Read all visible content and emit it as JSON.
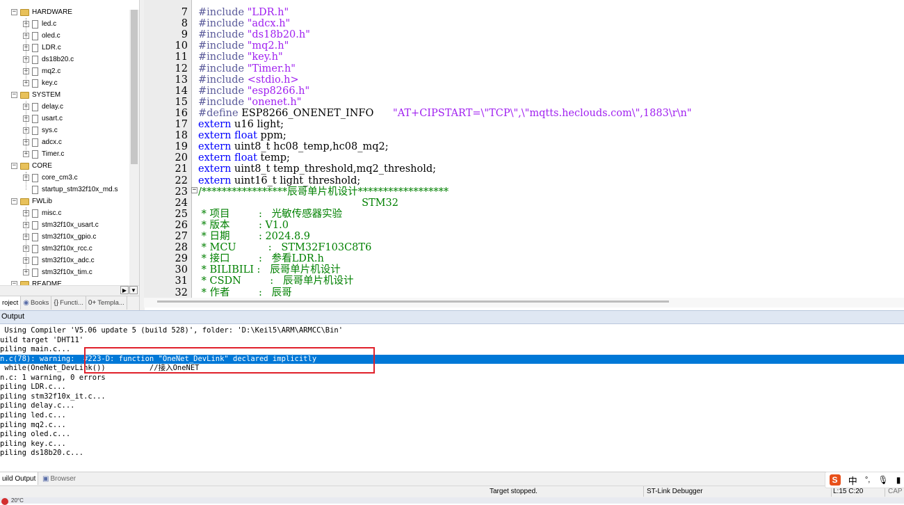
{
  "tree": {
    "groups": [
      {
        "name": "HARDWARE",
        "files": [
          "led.c",
          "oled.c",
          "LDR.c",
          "ds18b20.c",
          "mq2.c",
          "key.c"
        ]
      },
      {
        "name": "SYSTEM",
        "files": [
          "delay.c",
          "usart.c",
          "sys.c",
          "adcx.c",
          "Timer.c"
        ]
      },
      {
        "name": "CORE",
        "files": [
          "core_cm3.c",
          "startup_stm32f10x_md.s"
        ]
      },
      {
        "name": "FWLib",
        "files": [
          "misc.c",
          "stm32f10x_usart.c",
          "stm32f10x_gpio.c",
          "stm32f10x_rcc.c",
          "stm32f10x_adc.c",
          "stm32f10x_tim.c"
        ]
      },
      {
        "name": "README",
        "files": []
      }
    ]
  },
  "panel_tabs": [
    "roject",
    "Books",
    "Functi...",
    "Templa..."
  ],
  "editor": {
    "lines": [
      {
        "n": "7",
        "parts": [
          [
            "pp",
            "#include "
          ],
          [
            "st",
            "\"LDR.h\""
          ]
        ]
      },
      {
        "n": "8",
        "parts": [
          [
            "pp",
            "#include "
          ],
          [
            "st",
            "\"adcx.h\""
          ]
        ]
      },
      {
        "n": "9",
        "parts": [
          [
            "pp",
            "#include "
          ],
          [
            "st",
            "\"ds18b20.h\""
          ]
        ]
      },
      {
        "n": "10",
        "parts": [
          [
            "pp",
            "#include "
          ],
          [
            "st",
            "\"mq2.h\""
          ]
        ]
      },
      {
        "n": "11",
        "parts": [
          [
            "pp",
            "#include "
          ],
          [
            "st",
            "\"key.h\""
          ]
        ]
      },
      {
        "n": "12",
        "parts": [
          [
            "pp",
            "#include "
          ],
          [
            "st",
            "\"Timer.h\""
          ]
        ]
      },
      {
        "n": "13",
        "parts": [
          [
            "pp",
            "#include "
          ],
          [
            "st",
            "<stdio.h>"
          ]
        ]
      },
      {
        "n": "14",
        "parts": [
          [
            "pp",
            "#include "
          ],
          [
            "st",
            "\"esp8266.h\""
          ]
        ]
      },
      {
        "n": "15",
        "parts": [
          [
            "pp",
            "#include "
          ],
          [
            "st",
            "\"onenet.h\""
          ]
        ]
      },
      {
        "n": "16",
        "parts": [
          [
            "pp",
            "#define "
          ],
          [
            "tx",
            "ESP8266_ONENET_INFO      "
          ],
          [
            "st",
            "\"AT+CIPSTART=\\\"TCP\\\",\\\"mqtts.heclouds.com\\\",1883\\r\\n\""
          ]
        ]
      },
      {
        "n": "17",
        "parts": [
          [
            "kw",
            "extern "
          ],
          [
            "tx",
            "u16 light;"
          ]
        ]
      },
      {
        "n": "18",
        "parts": [
          [
            "kw",
            "extern float "
          ],
          [
            "tx",
            "ppm;"
          ]
        ]
      },
      {
        "n": "19",
        "parts": [
          [
            "kw",
            "extern "
          ],
          [
            "tx",
            "uint8_t hc08_temp,hc08_mq2;"
          ]
        ]
      },
      {
        "n": "20",
        "parts": [
          [
            "kw",
            "extern float "
          ],
          [
            "tx",
            "temp;"
          ]
        ]
      },
      {
        "n": "21",
        "parts": [
          [
            "kw",
            "extern "
          ],
          [
            "tx",
            "uint8_t temp_threshold,mq2_threshold;"
          ]
        ]
      },
      {
        "n": "22",
        "parts": [
          [
            "kw",
            "extern "
          ],
          [
            "tx",
            "uint16_t light_threshold;"
          ]
        ]
      },
      {
        "n": "23",
        "parts": [
          [
            "cm",
            "/*****************辰哥单片机设计******************"
          ]
        ]
      },
      {
        "n": "24",
        "parts": [
          [
            "cm",
            "                                                   STM32"
          ]
        ]
      },
      {
        "n": "25",
        "parts": [
          [
            "cm",
            " * 项目         :   光敏传感器实验"
          ]
        ]
      },
      {
        "n": "26",
        "parts": [
          [
            "cm",
            " * 版本         : V1.0"
          ]
        ]
      },
      {
        "n": "27",
        "parts": [
          [
            "cm",
            " * 日期         : 2024.8.9"
          ]
        ]
      },
      {
        "n": "28",
        "parts": [
          [
            "cm",
            " * MCU          :   STM32F103C8T6"
          ]
        ]
      },
      {
        "n": "29",
        "parts": [
          [
            "cm",
            " * 接口         :   参看LDR.h"
          ]
        ]
      },
      {
        "n": "30",
        "parts": [
          [
            "cm",
            " * BILIBILI :   辰哥单片机设计"
          ]
        ]
      },
      {
        "n": "31",
        "parts": [
          [
            "cm",
            " * CSDN         :   辰哥单片机设计"
          ]
        ]
      },
      {
        "n": "32",
        "parts": [
          [
            "cm",
            " * 作者         :   辰哥"
          ]
        ]
      }
    ]
  },
  "output": {
    "title": "Output",
    "lines": [
      " Using Compiler 'V5.06 update 5 (build 528)', folder: 'D:\\Keil5\\ARM\\ARMCC\\Bin'",
      "uild target 'DHT11'",
      "piling main.c...",
      "n.c(78): warning:  #223-D: function \"OneNet_DevLink\" declared implicitly",
      " while(OneNet_DevLink())          //接入OneNET",
      "n.c: 1 warning, 0 errors",
      "piling LDR.c...",
      "piling stm32f10x_it.c...",
      "piling delay.c...",
      "piling led.c...",
      "piling mq2.c...",
      "piling oled.c...",
      "piling key.c...",
      "piling ds18b20.c..."
    ],
    "selected_index": 3
  },
  "bottom_tabs": {
    "build": "uild Output",
    "browser": "Browser"
  },
  "status": {
    "target": "Target stopped.",
    "debugger": "ST-Link Debugger",
    "position": "L:15 C:20",
    "caps": "CAP"
  },
  "ime": {
    "lang": "中"
  },
  "taskbar": {
    "weather": "20°C"
  }
}
